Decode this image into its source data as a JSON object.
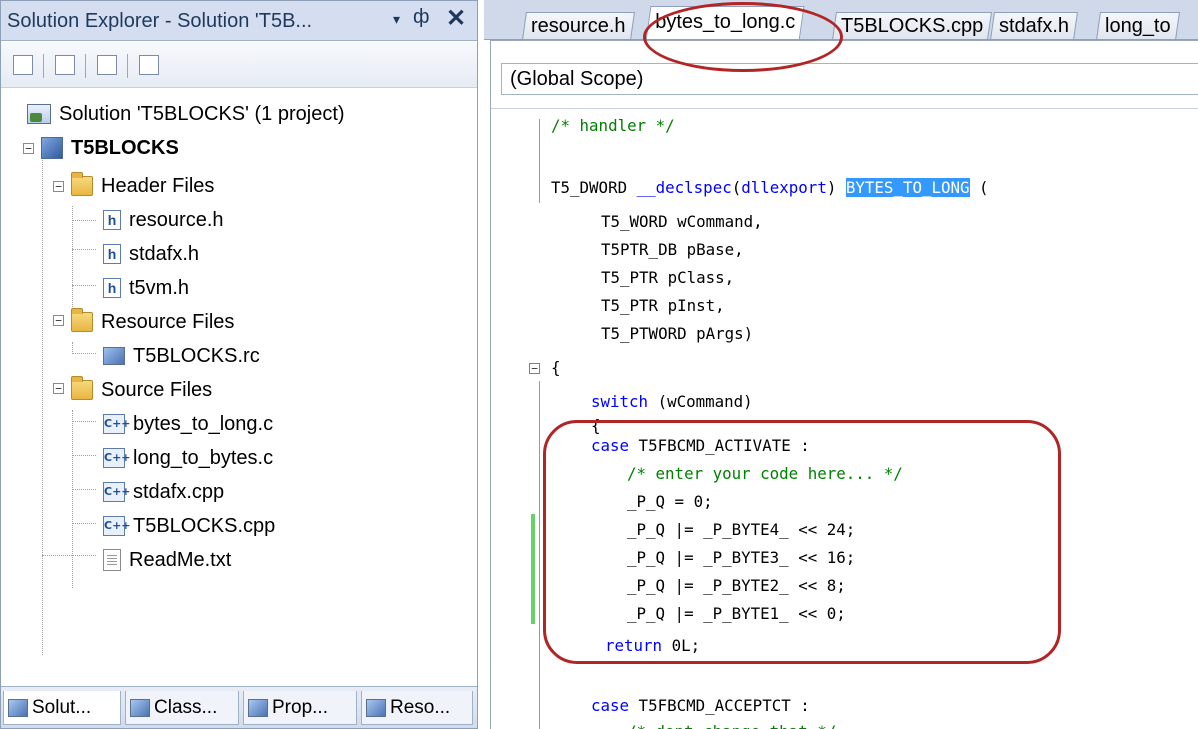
{
  "solution_explorer": {
    "title": "Solution Explorer - Solution 'T5B...",
    "controls": {
      "dropdown": "▾",
      "pin": "ф",
      "close": "✕"
    },
    "toolbar": [
      "properties-icon",
      "show-all-files-icon",
      "refresh-icon",
      "view-class-diagram-icon"
    ],
    "tree": {
      "solution": "Solution 'T5BLOCKS' (1 project)",
      "project": "T5BLOCKS",
      "header_folder": "Header Files",
      "header_files": [
        "resource.h",
        "stdafx.h",
        "t5vm.h"
      ],
      "resource_folder": "Resource Files",
      "resource_files": [
        "T5BLOCKS.rc"
      ],
      "source_folder": "Source Files",
      "source_files": [
        "bytes_to_long.c",
        "long_to_bytes.c",
        "stdafx.cpp",
        "T5BLOCKS.cpp"
      ],
      "readme": "ReadMe.txt"
    },
    "bottom_tabs": [
      "Solut...",
      "Class...",
      "Prop...",
      "Reso..."
    ]
  },
  "editor": {
    "tabs": [
      "resource.h",
      "bytes_to_long.c",
      "T5BLOCKS.cpp",
      "stdafx.h",
      "long_to"
    ],
    "active_tab": "bytes_to_long.c",
    "scope": "(Global Scope)",
    "code": {
      "l1": "/* handler */",
      "l2a": "T5_DWORD ",
      "l2b": "__declspec",
      "l2c": "(",
      "l2d": "dllexport",
      "l2e": ") ",
      "l2sel": "BYTES_TO_LONG",
      "l2f": " (",
      "l3": "T5_WORD wCommand,",
      "l4": "T5PTR_DB pBase,",
      "l5": "T5_PTR pClass,",
      "l6": "T5_PTR pInst,",
      "l7": "T5_PTWORD pArgs)",
      "l8": "{",
      "l9a": "switch",
      "l9b": " (wCommand)",
      "l10": "{",
      "l11a": "case",
      "l11b": " T5FBCMD_ACTIVATE :",
      "l12": "/* enter your code here... */",
      "l13": "_P_Q = 0;",
      "l14": "_P_Q |= _P_BYTE4_ << 24;",
      "l15": "_P_Q |= _P_BYTE3_ << 16;",
      "l16": "_P_Q |= _P_BYTE2_ << 8;",
      "l17": "_P_Q |= _P_BYTE1_ << 0;",
      "l18a": "return",
      "l18b": " 0L;",
      "l19a": "case",
      "l19b": " T5FBCMD_ACCEPTCT :",
      "l20": "/* dont change that */"
    }
  },
  "colors": {
    "keyword": "#0000ff",
    "comment": "#008000",
    "selection": "#3399ff",
    "annotation": "#b22525"
  }
}
